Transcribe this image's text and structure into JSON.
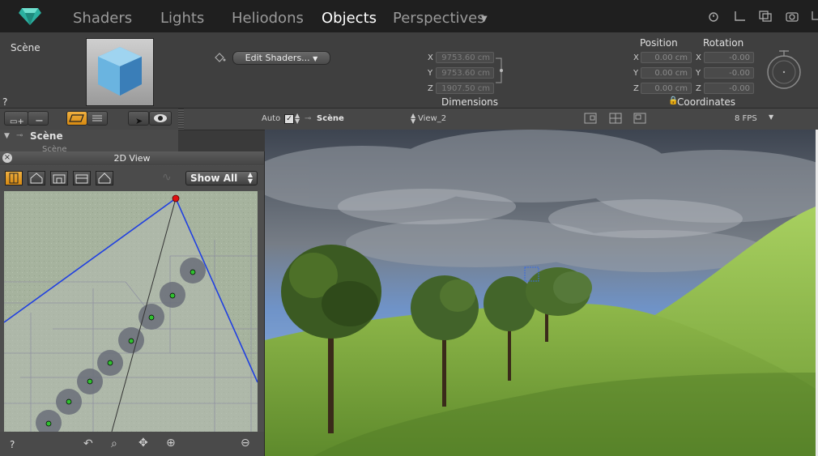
{
  "tabs": [
    {
      "label": "Shaders",
      "active": false
    },
    {
      "label": "Lights",
      "active": false
    },
    {
      "label": "Heliodons",
      "active": false
    },
    {
      "label": "Objects",
      "active": true
    },
    {
      "label": "Perspectives",
      "active": false
    }
  ],
  "inspector": {
    "scene_label": "Scène",
    "help": "?",
    "edit_shaders": "Edit Shaders...",
    "dimensions": {
      "title": "Dimensions",
      "x_label": "X",
      "x": "9753.60 cm",
      "y_label": "Y",
      "y": "9753.60 cm",
      "z_label": "Z",
      "z": "1907.50 cm"
    },
    "position": {
      "title": "Position",
      "x_label": "X",
      "x": "0.00 cm",
      "y_label": "Y",
      "y": "0.00 cm",
      "z_label": "Z",
      "z": "0.00 cm"
    },
    "rotation": {
      "title": "Rotation",
      "x_label": "X",
      "x": "-0.00",
      "y_label": "Y",
      "y": "-0.00",
      "z_label": "Z",
      "z": "-0.00"
    },
    "coordinates": "Coordinates"
  },
  "viewbar": {
    "auto": "Auto",
    "scene": "Scène",
    "view": "View_2",
    "fps": "8 FPS"
  },
  "tree": {
    "root": "Scène",
    "child": "Scène"
  },
  "view2d": {
    "title": "2D View",
    "show_all": "Show All",
    "help": "?"
  },
  "colors": {
    "accent_orange": "#e09a20",
    "frustum_blue": "#2040e0",
    "camera_red": "#e01010",
    "tree_marker_green": "#30c030"
  }
}
